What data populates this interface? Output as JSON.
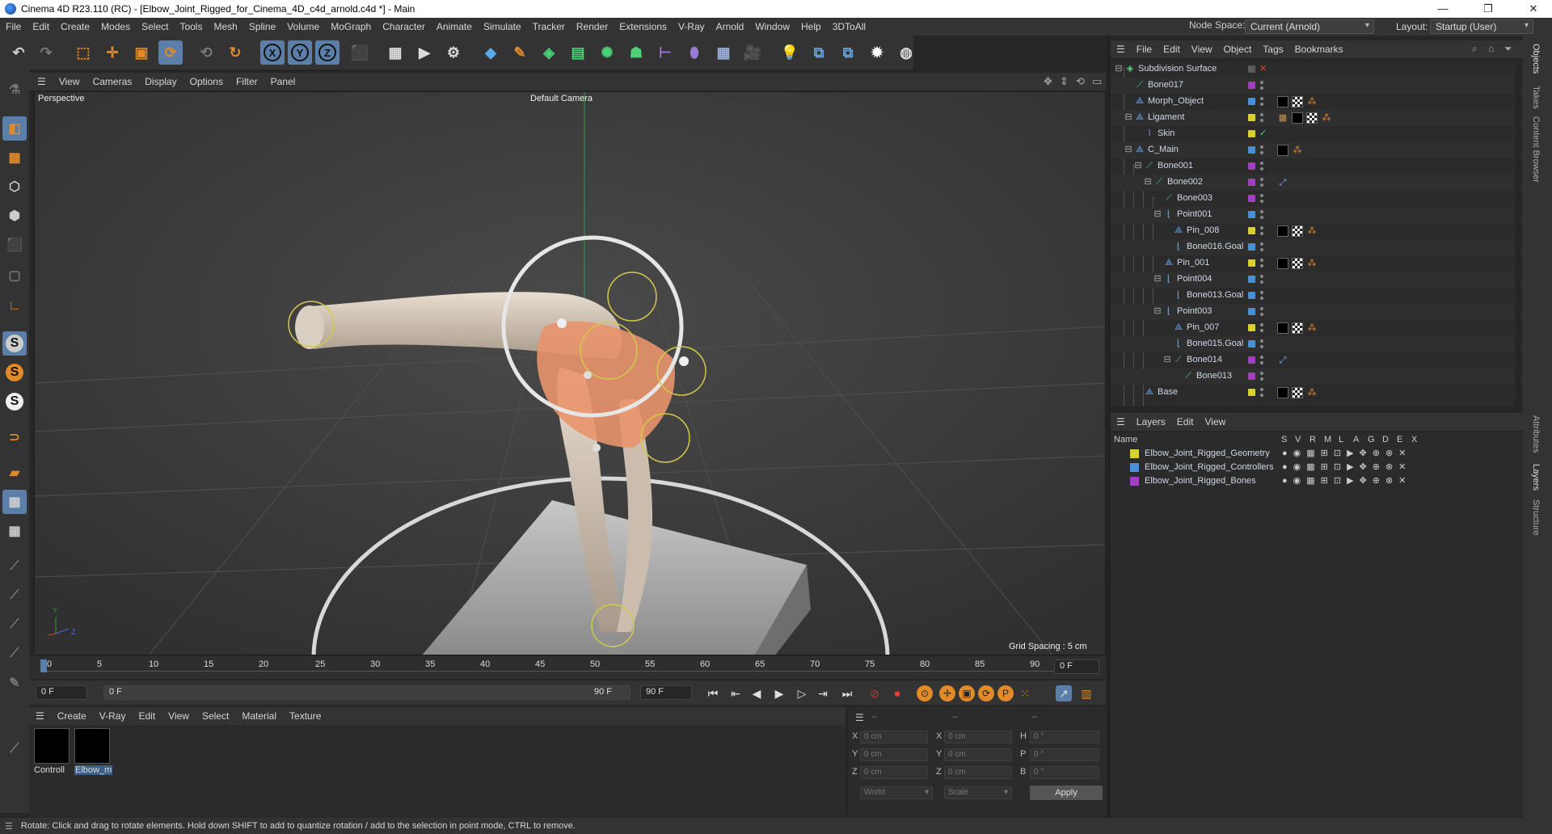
{
  "window": {
    "title": "Cinema 4D R23.110 (RC) - [Elbow_Joint_Rigged_for_Cinema_4D_c4d_arnold.c4d *] - Main",
    "minimize": "—",
    "maximize": "❐",
    "close": "✕"
  },
  "menubar": [
    "File",
    "Edit",
    "Create",
    "Modes",
    "Select",
    "Tools",
    "Mesh",
    "Spline",
    "Volume",
    "MoGraph",
    "Character",
    "Animate",
    "Simulate",
    "Tracker",
    "Render",
    "Extensions",
    "V-Ray",
    "Arnold",
    "Window",
    "Help",
    "3DToAll"
  ],
  "nodespace": {
    "label": "Node Space:",
    "value": "Current (Arnold)"
  },
  "layout": {
    "label": "Layout:",
    "value": "Startup (User)"
  },
  "toolbar_axes": [
    "X",
    "Y",
    "Z"
  ],
  "viewport": {
    "menu": [
      "View",
      "Cameras",
      "Display",
      "Options",
      "Filter",
      "Panel"
    ],
    "view_name": "Perspective",
    "camera": "Default Camera",
    "grid_spacing": "Grid Spacing : 5 cm",
    "axis_y": "Y",
    "axis_z": "Z"
  },
  "timeline": {
    "ticks": [
      "0",
      "5",
      "10",
      "15",
      "20",
      "25",
      "30",
      "35",
      "40",
      "45",
      "50",
      "55",
      "60",
      "65",
      "70",
      "75",
      "80",
      "85",
      "90"
    ],
    "current_frame": "0 F"
  },
  "transport": {
    "start": "0 F",
    "range_start": "0 F",
    "range_end": "90 F",
    "end": "90 F"
  },
  "material_menu": [
    "Create",
    "V-Ray",
    "Edit",
    "View",
    "Select",
    "Material",
    "Texture"
  ],
  "materials": [
    {
      "label": "Controll"
    },
    {
      "label": "Elbow_m"
    }
  ],
  "coords": {
    "header": [
      "--",
      "--",
      "--"
    ],
    "rows": [
      {
        "a": "X",
        "av": "0 cm",
        "b": "X",
        "bv": "0 cm",
        "c": "H",
        "cv": "0 °"
      },
      {
        "a": "Y",
        "av": "0 cm",
        "b": "Y",
        "bv": "0 cm",
        "c": "P",
        "cv": "0 °"
      },
      {
        "a": "Z",
        "av": "0 cm",
        "b": "Z",
        "bv": "0 cm",
        "c": "B",
        "cv": "0 °"
      }
    ],
    "space": "World",
    "mode": "Scale",
    "apply": "Apply"
  },
  "status": "Rotate: Click and drag to rotate elements. Hold down SHIFT to add to quantize rotation / add to the selection in point mode, CTRL to remove.",
  "object_menu": [
    "File",
    "Edit",
    "View",
    "Object",
    "Tags",
    "Bookmarks"
  ],
  "objects": [
    {
      "name": "Subdivision Surface",
      "color": "#5a5a5a",
      "icon": "subdivision-icon"
    },
    {
      "name": "Bone017",
      "color": "#a040c0",
      "icon": "bone-icon"
    },
    {
      "name": "Morph_Object",
      "color": "#4a90d9",
      "icon": "null-icon"
    },
    {
      "name": "Ligament",
      "color": "#d8d030",
      "icon": "null-icon"
    },
    {
      "name": "Skin",
      "color": "#d8d030",
      "icon": "skin-icon"
    },
    {
      "name": "C_Main",
      "color": "#4a90d9",
      "icon": "null-icon"
    },
    {
      "name": "Bone001",
      "color": "#a040c0",
      "icon": "bone-icon"
    },
    {
      "name": "Bone002",
      "color": "#a040c0",
      "icon": "bone-icon"
    },
    {
      "name": "Bone003",
      "color": "#a040c0",
      "icon": "bone-icon"
    },
    {
      "name": "Point001",
      "color": "#4a90d9",
      "icon": "point-icon"
    },
    {
      "name": "Pin_008",
      "color": "#d8d030",
      "icon": "null-icon"
    },
    {
      "name": "Bone016.Goal",
      "color": "#4a90d9",
      "icon": "point-icon"
    },
    {
      "name": "Pin_001",
      "color": "#d8d030",
      "icon": "null-icon"
    },
    {
      "name": "Point004",
      "color": "#4a90d9",
      "icon": "point-icon"
    },
    {
      "name": "Bone013.Goal",
      "color": "#4a90d9",
      "icon": "point-icon"
    },
    {
      "name": "Point003",
      "color": "#4a90d9",
      "icon": "point-icon"
    },
    {
      "name": "Pin_007",
      "color": "#d8d030",
      "icon": "null-icon"
    },
    {
      "name": "Bone015.Goal",
      "color": "#4a90d9",
      "icon": "point-icon"
    },
    {
      "name": "Bone014",
      "color": "#a040c0",
      "icon": "bone-icon"
    },
    {
      "name": "Bone013",
      "color": "#a040c0",
      "icon": "bone-icon"
    },
    {
      "name": "Base",
      "color": "#d8d030",
      "icon": "null-icon"
    }
  ],
  "layers_menu": [
    "Layers",
    "Edit",
    "View"
  ],
  "layers_cols": [
    "Name",
    "S",
    "V",
    "R",
    "M",
    "L",
    "A",
    "G",
    "D",
    "E",
    "X"
  ],
  "layers": [
    {
      "name": "Elbow_Joint_Rigged_Geometry",
      "color": "#d8d030"
    },
    {
      "name": "Elbow_Joint_Rigged_Controllers",
      "color": "#4a90d9"
    },
    {
      "name": "Elbow_Joint_Rigged_Bones",
      "color": "#a040c0"
    }
  ],
  "right_tabs": [
    "Objects",
    "Takes",
    "Content Browser",
    "Attributes",
    "Layers",
    "Structure"
  ]
}
